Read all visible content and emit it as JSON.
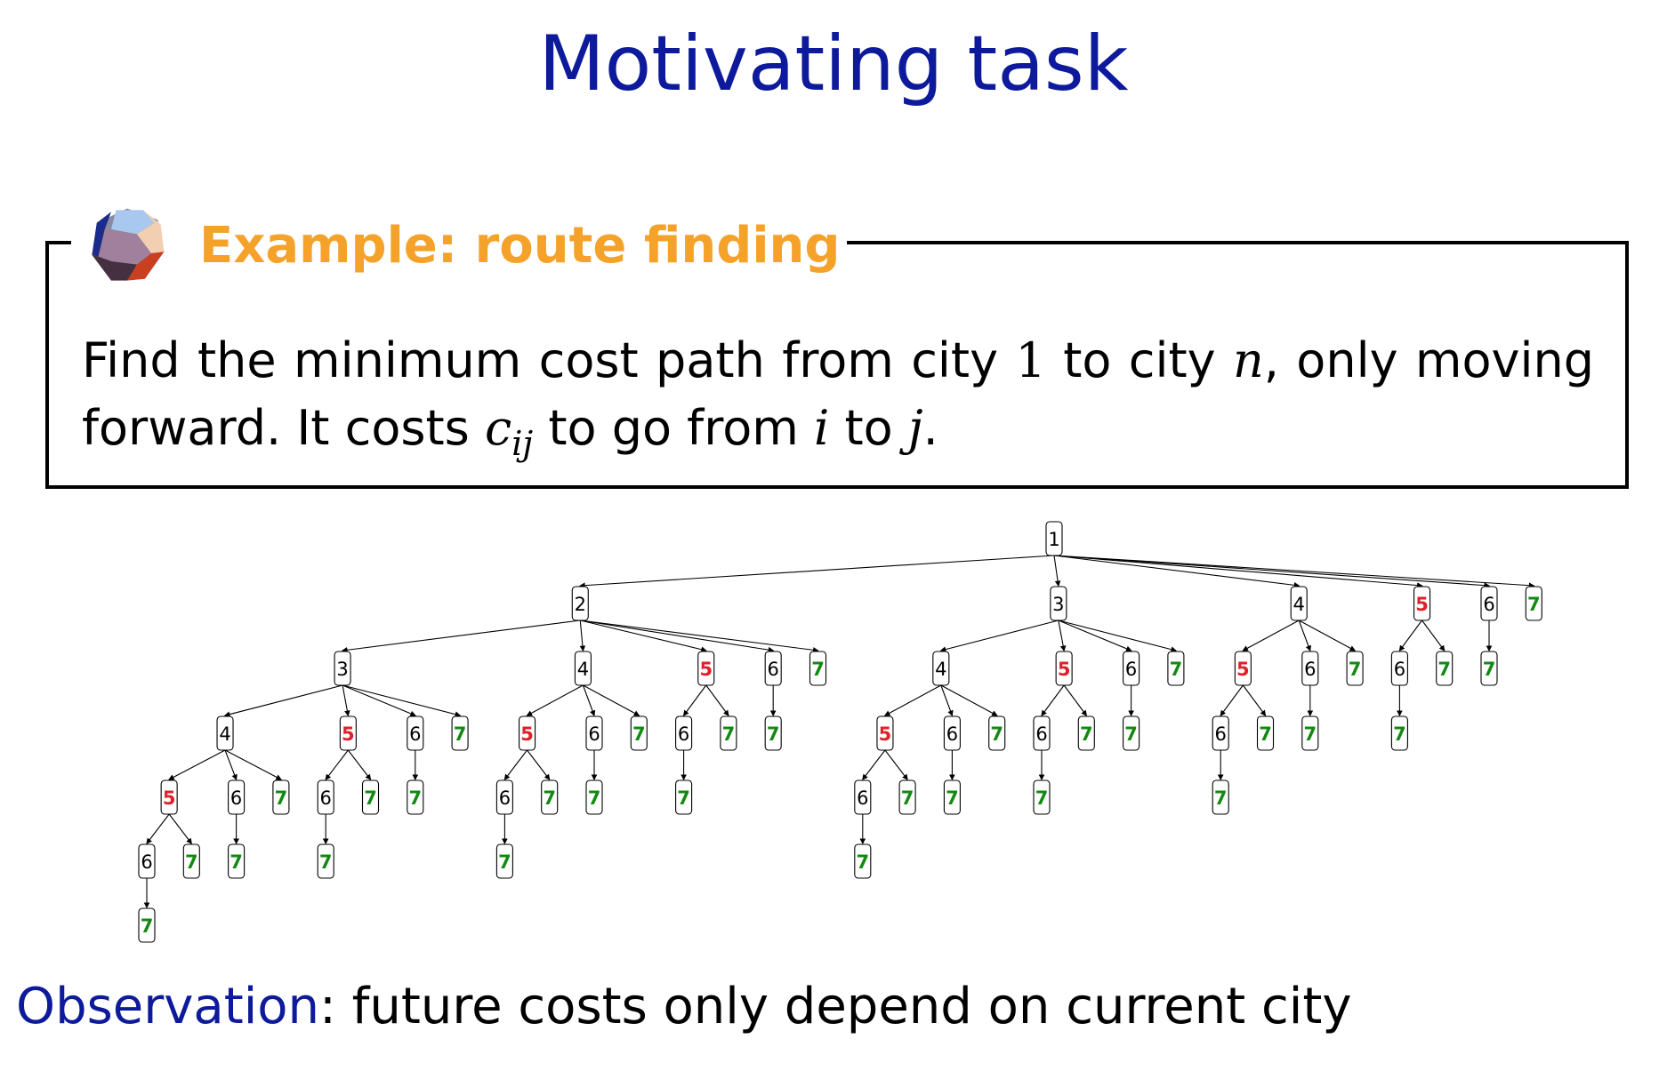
{
  "slide": {
    "title": "Motivating task"
  },
  "example": {
    "icon": "dodecahedron-icon",
    "title": "Example: route finding",
    "text_before_1": "Find the minimum cost path from city ",
    "one": "1",
    "text_to_city": " to city ",
    "n": "n",
    "text_after_n": ", only moving forward. It costs ",
    "c": "c",
    "ij": "ij",
    "text_go_from": " to go from ",
    "i": "i",
    "text_to": " to ",
    "j": "j",
    "text_end": "."
  },
  "observation": {
    "label": "Observation",
    "text": ": future costs only depend on current city"
  },
  "colors": {
    "title": "#0d1a9c",
    "example_title": "#f5a22a",
    "red_node": "#e0202a",
    "green_node": "#128a12"
  },
  "tree": {
    "labels": [
      "1",
      "2",
      "3",
      "4",
      "5",
      "6",
      "7"
    ],
    "root": {
      "l": "1",
      "c": [
        {
          "l": "2",
          "c": [
            {
              "l": "3",
              "c": [
                {
                  "l": "4",
                  "c": [
                    {
                      "l": "5",
                      "c": [
                        {
                          "l": "6",
                          "c": [
                            {
                              "l": "7"
                            }
                          ]
                        },
                        {
                          "l": "7"
                        }
                      ]
                    },
                    {
                      "l": "6",
                      "c": [
                        {
                          "l": "7"
                        }
                      ]
                    },
                    {
                      "l": "7"
                    }
                  ]
                },
                {
                  "l": "5",
                  "c": [
                    {
                      "l": "6",
                      "c": [
                        {
                          "l": "7"
                        }
                      ]
                    },
                    {
                      "l": "7"
                    }
                  ]
                },
                {
                  "l": "6",
                  "c": [
                    {
                      "l": "7"
                    }
                  ]
                },
                {
                  "l": "7"
                }
              ]
            },
            {
              "l": "4",
              "c": [
                {
                  "l": "5",
                  "c": [
                    {
                      "l": "6",
                      "c": [
                        {
                          "l": "7"
                        }
                      ]
                    },
                    {
                      "l": "7"
                    }
                  ]
                },
                {
                  "l": "6",
                  "c": [
                    {
                      "l": "7"
                    }
                  ]
                },
                {
                  "l": "7"
                }
              ]
            },
            {
              "l": "5",
              "c": [
                {
                  "l": "6",
                  "c": [
                    {
                      "l": "7"
                    }
                  ]
                },
                {
                  "l": "7"
                }
              ]
            },
            {
              "l": "6",
              "c": [
                {
                  "l": "7"
                }
              ]
            },
            {
              "l": "7"
            }
          ]
        },
        {
          "l": "3",
          "c": [
            {
              "l": "4",
              "c": [
                {
                  "l": "5",
                  "c": [
                    {
                      "l": "6",
                      "c": [
                        {
                          "l": "7"
                        }
                      ]
                    },
                    {
                      "l": "7"
                    }
                  ]
                },
                {
                  "l": "6",
                  "c": [
                    {
                      "l": "7"
                    }
                  ]
                },
                {
                  "l": "7"
                }
              ]
            },
            {
              "l": "5",
              "c": [
                {
                  "l": "6",
                  "c": [
                    {
                      "l": "7"
                    }
                  ]
                },
                {
                  "l": "7"
                }
              ]
            },
            {
              "l": "6",
              "c": [
                {
                  "l": "7"
                }
              ]
            },
            {
              "l": "7"
            }
          ]
        },
        {
          "l": "4",
          "c": [
            {
              "l": "5",
              "c": [
                {
                  "l": "6",
                  "c": [
                    {
                      "l": "7"
                    }
                  ]
                },
                {
                  "l": "7"
                }
              ]
            },
            {
              "l": "6",
              "c": [
                {
                  "l": "7"
                }
              ]
            },
            {
              "l": "7"
            }
          ]
        },
        {
          "l": "5",
          "c": [
            {
              "l": "6",
              "c": [
                {
                  "l": "7"
                }
              ]
            },
            {
              "l": "7"
            }
          ]
        },
        {
          "l": "6",
          "c": [
            {
              "l": "7"
            }
          ]
        },
        {
          "l": "7"
        }
      ]
    }
  }
}
